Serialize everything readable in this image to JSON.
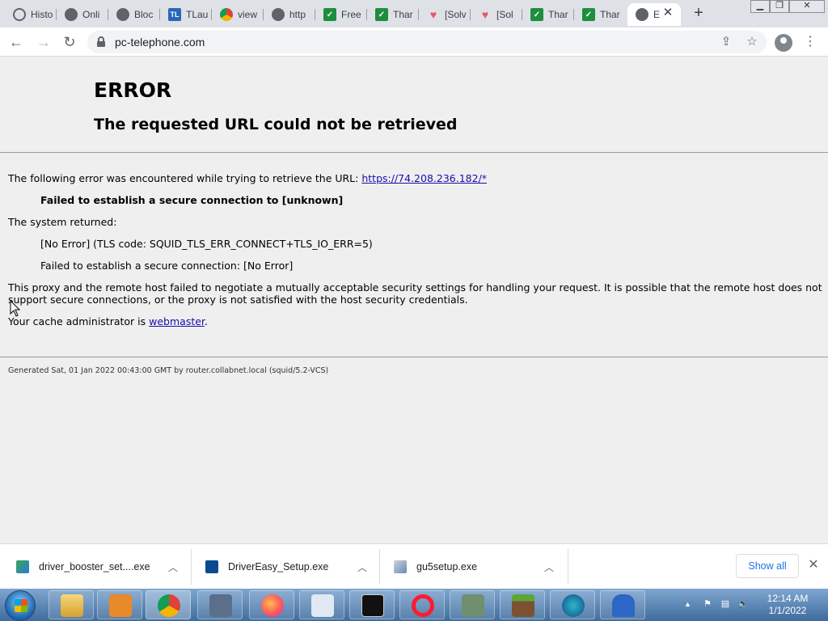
{
  "tabs": [
    {
      "title": "Histo",
      "icon": "history-icon"
    },
    {
      "title": "Onli",
      "icon": "globe-icon"
    },
    {
      "title": "Bloc",
      "icon": "globe-icon"
    },
    {
      "title": "TLau",
      "icon": "tl-logo-icon"
    },
    {
      "title": "view",
      "icon": "chrome-icon"
    },
    {
      "title": "http",
      "icon": "globe-icon"
    },
    {
      "title": "Free",
      "icon": "green-check-icon"
    },
    {
      "title": "Thar",
      "icon": "green-check-icon"
    },
    {
      "title": "[Solv",
      "icon": "heart-icon"
    },
    {
      "title": "[Sol",
      "icon": "heart-icon"
    },
    {
      "title": "Thar",
      "icon": "green-check-icon"
    },
    {
      "title": "Thar",
      "icon": "green-check-icon"
    },
    {
      "title": "E",
      "icon": "globe-icon",
      "active": true
    }
  ],
  "address_bar": {
    "url": "pc-telephone.com"
  },
  "error_page": {
    "title": "ERROR",
    "subtitle": "The requested URL could not be retrieved",
    "encountered_text": "The following error was encountered while trying to retrieve the URL:",
    "url_link": "https://74.208.236.182/*",
    "failed_strong": "Failed to establish a secure connection to [unknown]",
    "system_returned": "The system returned:",
    "no_error_line": "[No Error] (TLS code: SQUID_TLS_ERR_CONNECT+TLS_IO_ERR=5)",
    "failed_secure_line": "Failed to establish a secure connection: [No Error]",
    "explanation_1": "This proxy and the remote host failed to negotiate a mutually acceptable security settings for handling your request. It is possible that the remote host does not",
    "explanation_2": "support secure connections, or the proxy is not satisfied with the host security credentials.",
    "admin_prefix": "Your cache administrator is",
    "admin_link": "webmaster",
    "admin_suffix": ".",
    "generated": "Generated Sat, 01 Jan 2022 00:43:00 GMT by router.collabnet.local (squid/5.2-VCS)"
  },
  "downloads": [
    {
      "filename": "driver_booster_set....exe",
      "icon": "installer-icon"
    },
    {
      "filename": "DriverEasy_Setup.exe",
      "icon": "drivereasy-icon"
    },
    {
      "filename": "gu5setup.exe",
      "icon": "setup-icon"
    }
  ],
  "download_shelf": {
    "show_all": "Show all"
  },
  "clock": {
    "time": "12:14 AM",
    "date": "1/1/2022"
  },
  "colors": {
    "link": "#1a0dab",
    "show_all": "#1a73e8"
  }
}
